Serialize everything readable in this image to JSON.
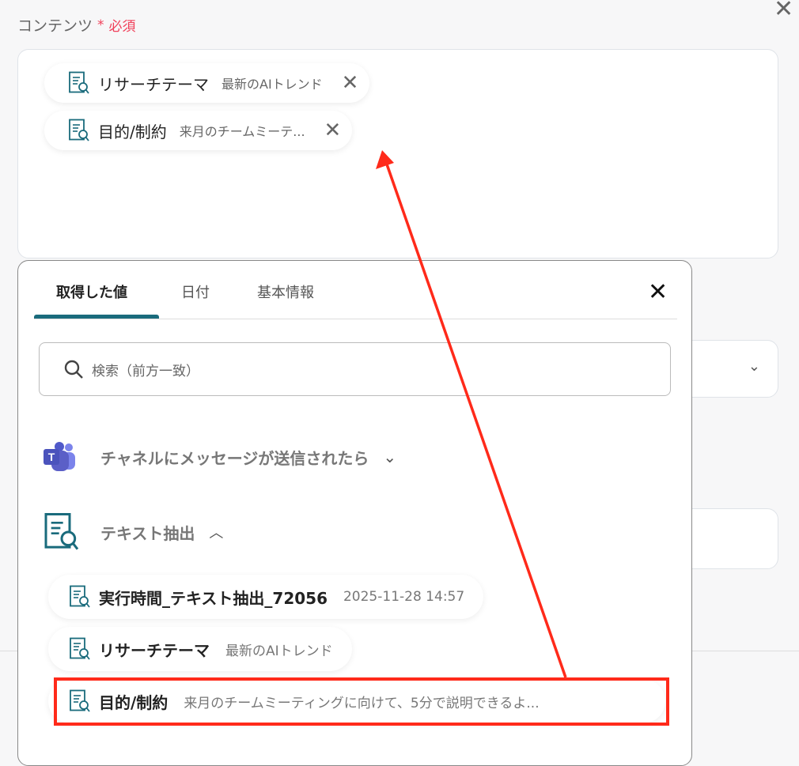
{
  "field": {
    "label": "コンテンツ",
    "required_mark": "*",
    "required_text": "必須"
  },
  "chips": [
    {
      "name": "リサーチテーマ",
      "value": "最新のAIトレンド"
    },
    {
      "name": "目的/制約",
      "value": "来月のチームミーテ..."
    }
  ],
  "popup": {
    "tabs": [
      {
        "label": "取得した値"
      },
      {
        "label": "日付"
      },
      {
        "label": "基本情報"
      }
    ],
    "search_placeholder": "検索（前方一致）",
    "sections": [
      {
        "label": "チャネルにメッセージが送信されたら"
      },
      {
        "label": "テキスト抽出"
      }
    ],
    "items": [
      {
        "name": "実行時間_テキスト抽出_72056",
        "value": "2025-11-28 14:57"
      },
      {
        "name": "リサーチテーマ",
        "value": "最新のAIトレンド"
      },
      {
        "name": "目的/制約",
        "value": "来月のチームミーティングに向けて、5分で説明できるよ..."
      }
    ]
  },
  "colors": {
    "accent": "#1a6b7c",
    "required": "#f0405a",
    "annotation": "#ff2a1a"
  }
}
